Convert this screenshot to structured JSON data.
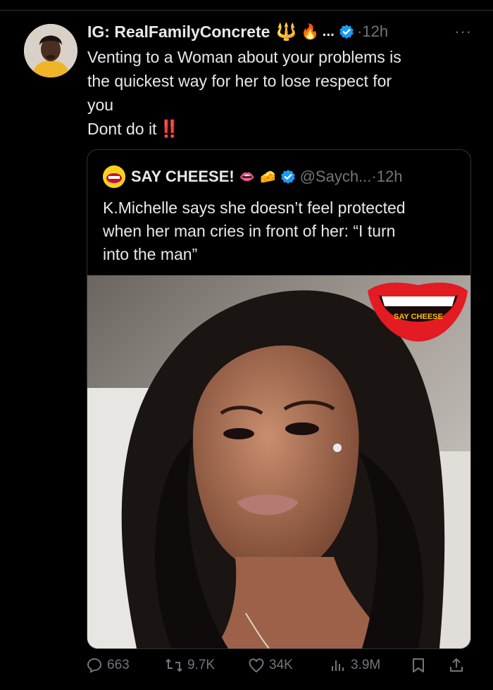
{
  "post": {
    "display_name": "IG: RealFamilyConcrete",
    "name_emojis": [
      "🔱",
      "🔥"
    ],
    "ellipsis": "...",
    "time": "·12h",
    "more": "···",
    "text_lines": [
      "Venting to a Woman about your problems is",
      "the quickest way for her to lose respect for",
      "you",
      "Dont do it"
    ],
    "bang": "‼️"
  },
  "quoted": {
    "name": "SAY CHEESE!",
    "name_emojis": [
      "👄",
      "🧀"
    ],
    "handle": "@Saych...",
    "time": "·12h",
    "text_lines": [
      "K.Michelle says she doesn’t feel protected",
      "when her man cries in front of her: “I turn",
      "into the man”"
    ],
    "media_logo_text": "SAY CHEESE"
  },
  "actions": {
    "replies": "663",
    "reposts": "9.7K",
    "likes": "34K",
    "views": "3.9M"
  },
  "colors": {
    "background": "#000000",
    "text": "#e7e9ea",
    "muted": "#71767b",
    "verified": "#1d9bf0",
    "border": "#2f3336"
  }
}
